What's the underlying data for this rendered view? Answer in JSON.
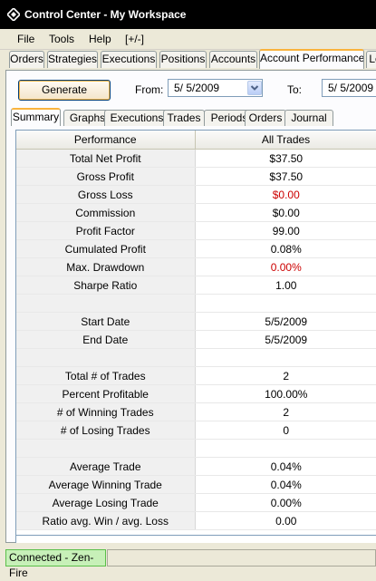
{
  "window": {
    "title": "Control Center - My Workspace"
  },
  "menu": [
    "File",
    "Tools",
    "Help",
    "[+/-]"
  ],
  "main_tabs": [
    "Orders",
    "Strategies",
    "Executions",
    "Positions",
    "Accounts",
    "Account Performance",
    "Lo"
  ],
  "toolbar": {
    "generate_label": "Generate",
    "from_label": "From:",
    "from_value": "5/  5/2009",
    "to_label": "To:",
    "to_value": "5/  5/2009"
  },
  "sub_tabs": [
    "Summary",
    "Graphs",
    "Executions",
    "Trades",
    "Periods",
    "Orders",
    "Journal"
  ],
  "table": {
    "headers": [
      "Performance",
      "All Trades"
    ],
    "rows": [
      [
        "Total Net Profit",
        "$37.50"
      ],
      [
        "Gross Profit",
        "$37.50"
      ],
      [
        "Gross Loss",
        "$0.00"
      ],
      [
        "Commission",
        "$0.00"
      ],
      [
        "Profit Factor",
        "99.00"
      ],
      [
        "Cumulated Profit",
        "0.08%"
      ],
      [
        "Max. Drawdown",
        "0.00%"
      ],
      [
        "Sharpe Ratio",
        "1.00"
      ],
      [
        "",
        ""
      ],
      [
        "Start Date",
        "5/5/2009"
      ],
      [
        "End Date",
        "5/5/2009"
      ],
      [
        "",
        ""
      ],
      [
        "Total # of Trades",
        "2"
      ],
      [
        "Percent Profitable",
        "100.00%"
      ],
      [
        "# of Winning Trades",
        "2"
      ],
      [
        "# of Losing Trades",
        "0"
      ],
      [
        "",
        ""
      ],
      [
        "Average Trade",
        "0.04%"
      ],
      [
        "Average Winning Trade",
        "0.04%"
      ],
      [
        "Average Losing Trade",
        "0.00%"
      ],
      [
        "Ratio avg. Win / avg. Loss",
        "0.00"
      ]
    ],
    "red_rows": [
      2,
      6
    ]
  },
  "status": {
    "connection": "Connected - Zen-Fire"
  },
  "colors": {
    "loss_red": "#cc0000",
    "connected_green": "#c7f0b8",
    "active_tab_accent": "#f9b33d"
  }
}
